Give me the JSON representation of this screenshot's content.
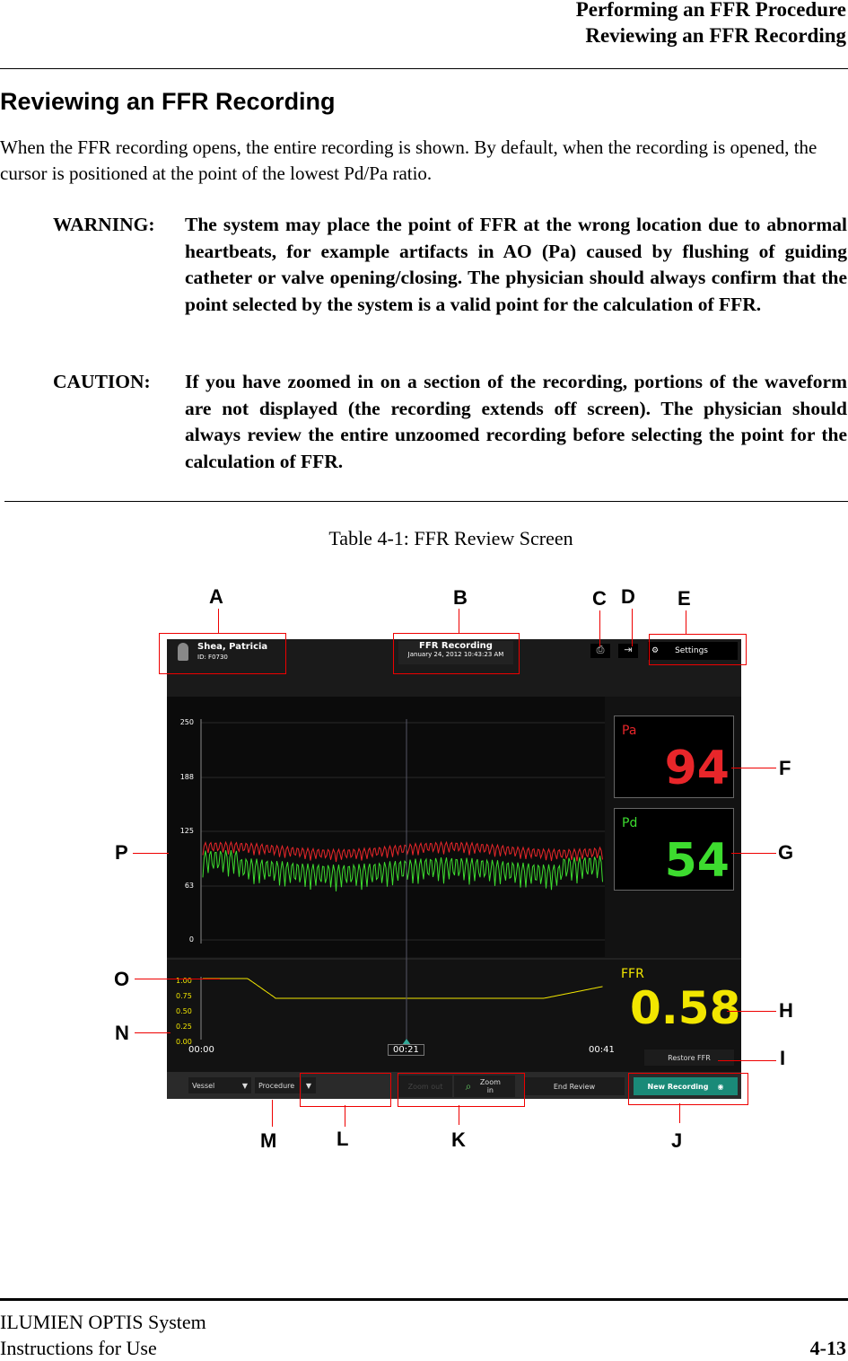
{
  "header": {
    "line1": "Performing an FFR Procedure",
    "line2": "Reviewing an FFR Recording"
  },
  "title": "Reviewing an FFR Recording",
  "intro": "When the FFR recording opens, the entire recording is shown. By default, when the recording is opened, the cursor is positioned at the point of the lowest Pd/Pa ratio.",
  "warning": {
    "label": "WARNING:",
    "text": "The system may place the point of FFR at the wrong location due to abnormal heartbeats, for example artifacts in AO (Pa) caused by flushing of guiding catheter or valve opening/closing. The physician should always confirm that the point selected by the system is a valid point for the calculation of FFR."
  },
  "caution": {
    "label": "CAUTION:",
    "text": "If you have zoomed in on a section of the recording, portions of the waveform are not displayed (the recording extends off screen). The physician should always review the entire unzoomed recording before selecting the point for the calculation of FFR."
  },
  "caption": "Table 4-1:  FFR Review Screen",
  "callouts": {
    "A": "A",
    "B": "B",
    "C": "C",
    "D": "D",
    "E": "E",
    "F": "F",
    "G": "G",
    "H": "H",
    "I": "I",
    "J": "J",
    "K": "K",
    "L": "L",
    "M": "M",
    "N": "N",
    "O": "O",
    "P": "P"
  },
  "screen": {
    "patient_name": "Shea, Patricia",
    "patient_id": "ID: F0730",
    "rec_title": "FFR Recording",
    "rec_date": "January 24, 2012  10:43:23 AM",
    "settings": "Settings",
    "pa_label": "Pa",
    "pa_value": "94",
    "pd_label": "Pd",
    "pd_value": "54",
    "ffr_label": "FFR",
    "ffr_value": "0.58",
    "pressure_ticks": [
      "250",
      "188",
      "125",
      "63",
      "0"
    ],
    "ffr_ticks": [
      "1.00",
      "0.75",
      "0.50",
      "0.25",
      "0.00"
    ],
    "time_start": "00:00",
    "time_cursor": "00:21",
    "time_end": "00:41",
    "restore": "Restore FFR",
    "vessel": "Vessel",
    "procedure": "Procedure",
    "zoom_out": "Zoom out",
    "zoom_in": "Zoom in",
    "end_review": "End Review",
    "new_recording": "New Recording",
    "colors": {
      "pa": "#e8262a",
      "pd": "#3ddc2f",
      "ffr": "#f2e600",
      "new_recording": "#1a8a78"
    }
  },
  "footer": {
    "product": "ILUMIEN OPTIS System",
    "doc": "Instructions for Use",
    "page": "4-13"
  }
}
